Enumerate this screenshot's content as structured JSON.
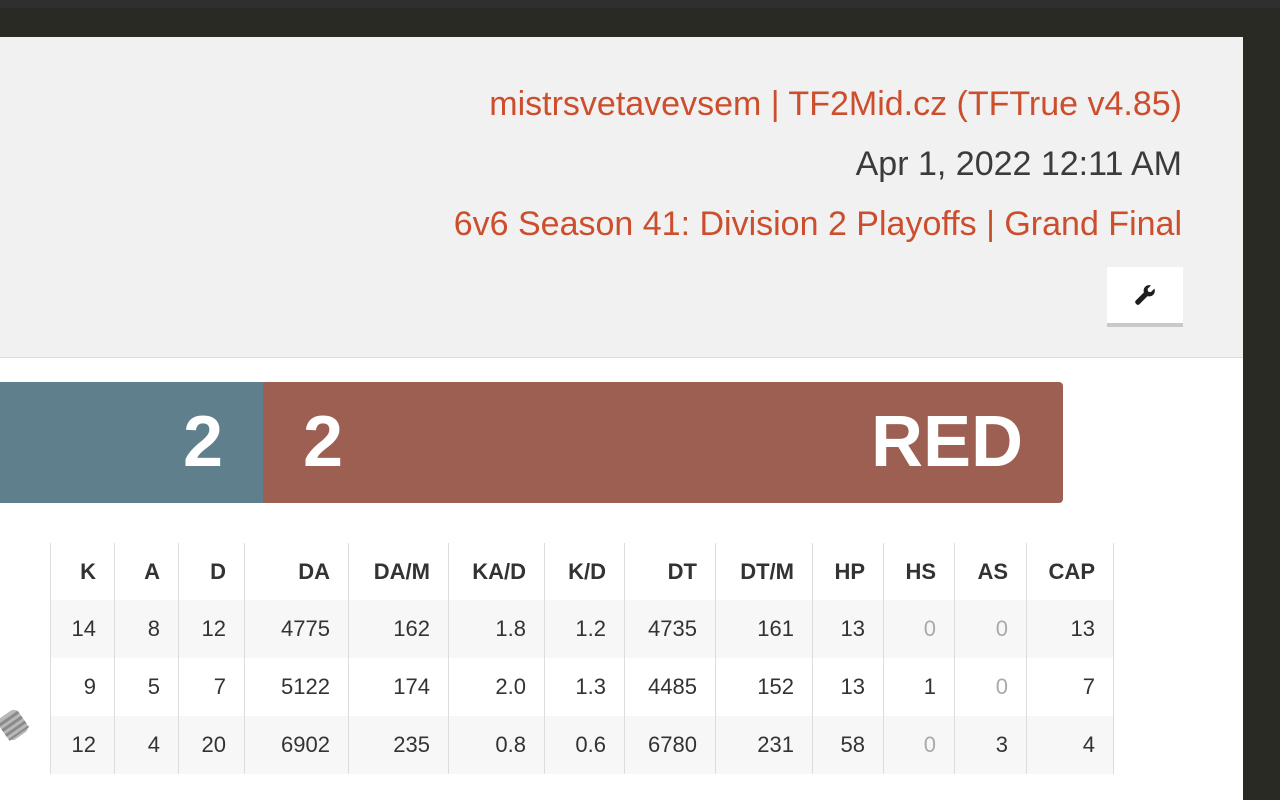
{
  "header": {
    "server": "mistrsvetavevsem | TF2Mid.cz (TFTrue v4.85)",
    "date": "Apr 1, 2022 12:11 AM",
    "match": "6v6 Season 41: Division 2 Playoffs | Grand Final",
    "tools_icon": "wrench-icon"
  },
  "score": {
    "blu_score": "2",
    "red_score": "2",
    "red_name": "RED",
    "colors": {
      "blu": "#5f7f8d",
      "red": "#9d5f52",
      "accent": "#cc4e2c"
    }
  },
  "stats": {
    "columns": [
      "K",
      "A",
      "D",
      "DA",
      "DA/M",
      "KA/D",
      "K/D",
      "DT",
      "DT/M",
      "HP",
      "HS",
      "AS",
      "CAP"
    ],
    "rows": [
      [
        "14",
        "8",
        "12",
        "4775",
        "162",
        "1.8",
        "1.2",
        "4735",
        "161",
        "13",
        "0",
        "0",
        "13"
      ],
      [
        "9",
        "5",
        "7",
        "5122",
        "174",
        "2.0",
        "1.3",
        "4485",
        "152",
        "13",
        "1",
        "0",
        "7"
      ],
      [
        "12",
        "4",
        "20",
        "6902",
        "235",
        "0.8",
        "0.6",
        "6780",
        "231",
        "58",
        "0",
        "3",
        "4"
      ]
    ],
    "row2_class_icon": "demoman-icon"
  }
}
